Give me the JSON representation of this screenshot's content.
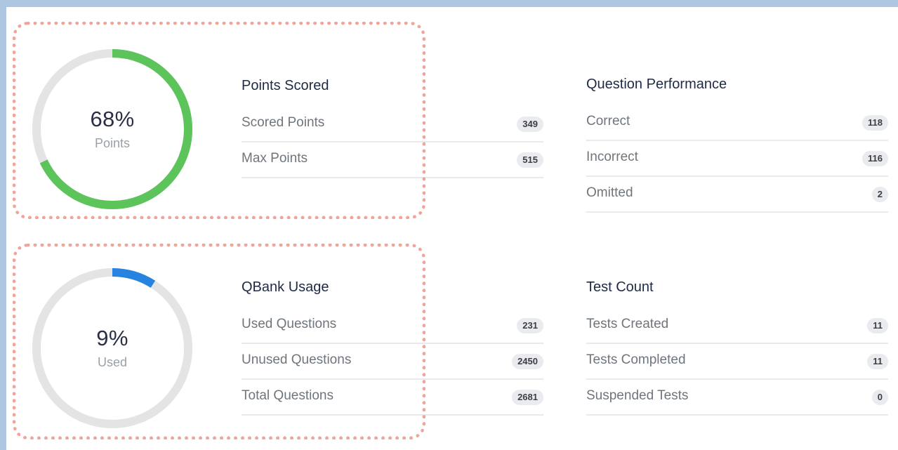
{
  "points_ring": {
    "percent_label": "68%",
    "sub_label": "Points",
    "fraction": 0.68,
    "color": "#5cc45a",
    "track_color": "#e4e4e4"
  },
  "usage_ring": {
    "percent_label": "9%",
    "sub_label": "Used",
    "fraction": 0.09,
    "color": "#2783e0",
    "track_color": "#e4e4e4"
  },
  "points_scored": {
    "title": "Points Scored",
    "rows": [
      {
        "label": "Scored Points",
        "value": "349"
      },
      {
        "label": "Max Points",
        "value": "515"
      }
    ]
  },
  "question_performance": {
    "title": "Question Performance",
    "rows": [
      {
        "label": "Correct",
        "value": "118"
      },
      {
        "label": "Incorrect",
        "value": "116"
      },
      {
        "label": "Omitted",
        "value": "2"
      }
    ]
  },
  "qbank_usage": {
    "title": "QBank Usage",
    "rows": [
      {
        "label": "Used Questions",
        "value": "231"
      },
      {
        "label": "Unused Questions",
        "value": "2450"
      },
      {
        "label": "Total Questions",
        "value": "2681"
      }
    ]
  },
  "test_count": {
    "title": "Test Count",
    "rows": [
      {
        "label": "Tests Created",
        "value": "11"
      },
      {
        "label": "Tests Completed",
        "value": "11"
      },
      {
        "label": "Suspended Tests",
        "value": "0"
      }
    ]
  }
}
